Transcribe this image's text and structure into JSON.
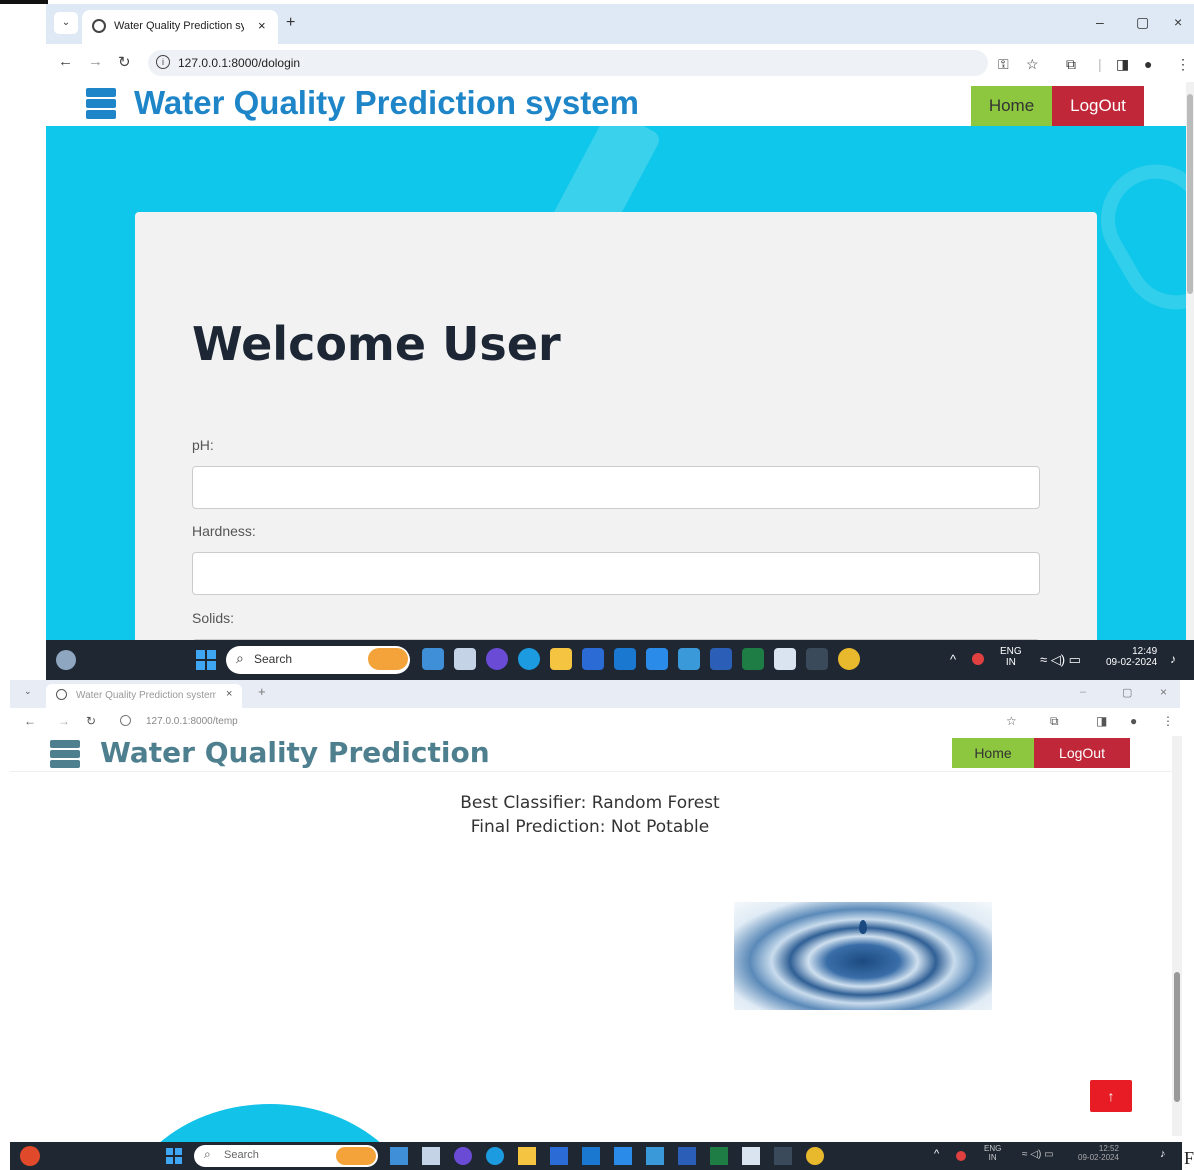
{
  "first_window": {
    "tab": {
      "title": "Water Quality Prediction system",
      "close": "×",
      "new_tab": "+"
    },
    "window_controls": {
      "minimize": "–",
      "restore": "▢",
      "close": "×"
    },
    "address": {
      "url": "127.0.0.1:8000/dologin"
    },
    "navbar": {
      "brand": "Water Quality Prediction system",
      "home": "Home",
      "logout": "LogOut"
    },
    "card": {
      "heading": "Welcome User",
      "fields": [
        {
          "label": "pH:",
          "value": ""
        },
        {
          "label": "Hardness:",
          "value": ""
        },
        {
          "label": "Solids:",
          "value": ""
        }
      ]
    },
    "taskbar": {
      "search": "Search",
      "lang": "ENG",
      "region": "IN",
      "time": "12:49",
      "date": "09-02-2024"
    }
  },
  "second_window": {
    "tab": {
      "title": "Water Quality Prediction system",
      "close": "×",
      "new_tab": "+"
    },
    "address": {
      "url": "127.0.0.1:8000/temp"
    },
    "navbar": {
      "brand": "Water Quality Prediction",
      "home": "Home",
      "logout": "LogOut"
    },
    "result": {
      "best_classifier": "Best Classifier: Random Forest",
      "final_prediction": "Final Prediction: Not Potable"
    },
    "scroll_top_icon": "↑",
    "taskbar": {
      "search": "Search",
      "lang": "ENG",
      "region": "IN",
      "time": "12:52",
      "date": "09-02-2024"
    }
  },
  "edge_fragment": "F",
  "colors": {
    "brand_blue": "#1e86c8",
    "hero_cyan": "#0fc7ea",
    "home_green": "#8dc63f",
    "logout_red": "#c0283a",
    "to_top_red": "#e81c24",
    "taskbar": "#1f2733"
  }
}
